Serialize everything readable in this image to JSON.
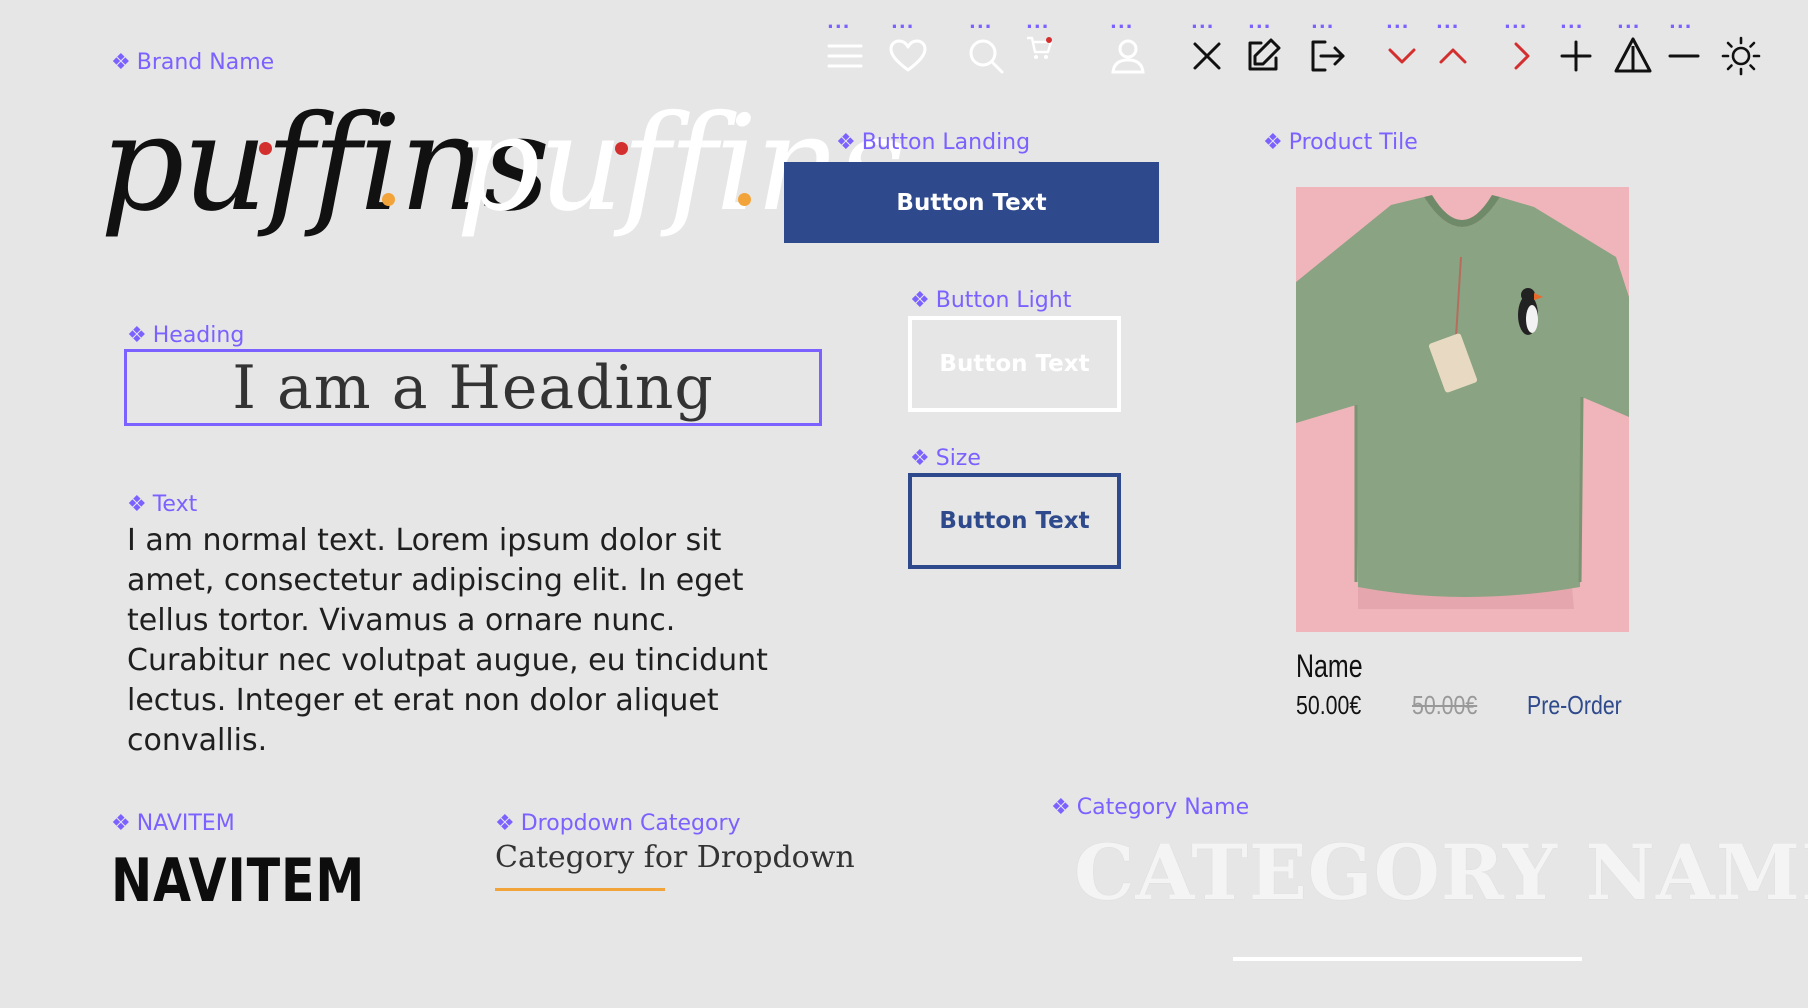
{
  "labels": {
    "brand_name": "Brand Name",
    "button_landing": "Button Landing",
    "product_tile": "Product Tile",
    "heading": "Heading",
    "button_light": "Button Light",
    "size": "Size",
    "text": "Text",
    "navitem": "NAVITEM",
    "dropdown_category": "Dropdown Category",
    "category_name": "Category Name"
  },
  "icon_dots": "...",
  "icons": [
    "menu-icon",
    "heart-icon",
    "search-icon",
    "cart-icon",
    "user-icon",
    "close-icon",
    "edit-icon",
    "logout-icon",
    "chevron-down-icon",
    "chevron-up-icon",
    "chevron-right-icon",
    "plus-icon",
    "warning-icon",
    "minus-icon",
    "sun-icon"
  ],
  "brand": {
    "logo_text": "puffins"
  },
  "heading": {
    "text": "I am a Heading"
  },
  "body_text": "I am normal text. Lorem ipsum dolor sit amet, consectetur adipiscing elit. In eget tellus tortor. Vivamus a ornare nunc. Curabitur nec volutpat augue, eu tincidunt lectus. Integer et erat non dolor aliquet convallis.",
  "buttons": {
    "landing": "Button Text",
    "light": "Button Text",
    "size": "Button Text"
  },
  "product": {
    "name": "Name",
    "price": "50.00€",
    "old_price": "50.00€",
    "status": "Pre-Order"
  },
  "navitem": "NAVITEM",
  "dropdown_category": "Category for Dropdown",
  "category_name": "CATEGORY NAME",
  "colors": {
    "accent": "#7b61ff",
    "primary": "#2e4a8c",
    "red": "#d32f2f",
    "orange": "#f2a43a",
    "background": "#e6e6e6"
  }
}
